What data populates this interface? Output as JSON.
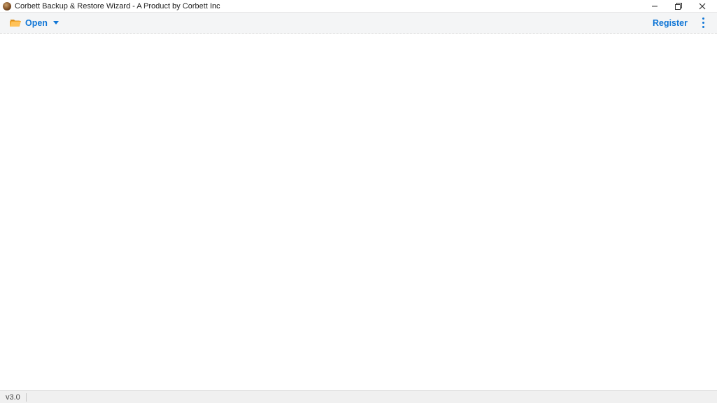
{
  "window": {
    "title": "Corbett Backup & Restore Wizard - A Product by Corbett Inc"
  },
  "toolbar": {
    "open_label": "Open",
    "register_label": "Register"
  },
  "statusbar": {
    "version": "v3.0"
  },
  "colors": {
    "accent": "#1076d6",
    "folder": "#f2a62b"
  }
}
